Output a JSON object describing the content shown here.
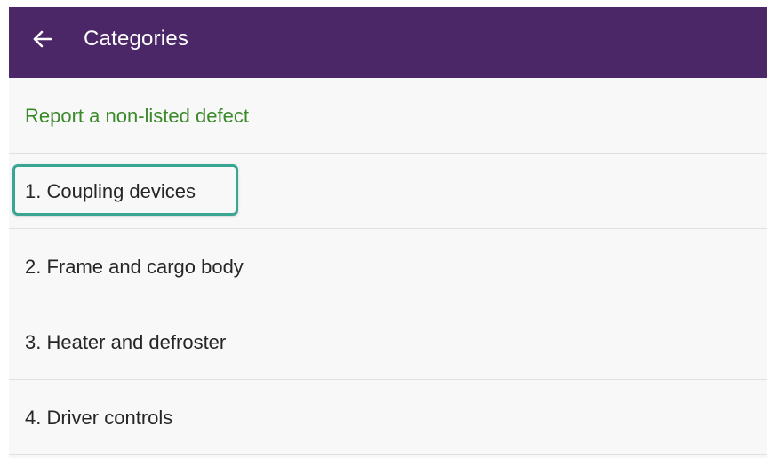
{
  "appbar": {
    "back_icon": "arrow-left-icon",
    "title": "Categories",
    "background_color": "#4b2767"
  },
  "list": {
    "report_label": "Report a non-listed defect",
    "report_color": "#3a8a2a",
    "items": [
      {
        "label": "1. Coupling devices",
        "highlighted": true
      },
      {
        "label": "2. Frame and cargo body",
        "highlighted": false
      },
      {
        "label": "3. Heater and defroster",
        "highlighted": false
      },
      {
        "label": "4. Driver controls",
        "highlighted": false
      }
    ],
    "highlight_color": "#3aa592"
  }
}
